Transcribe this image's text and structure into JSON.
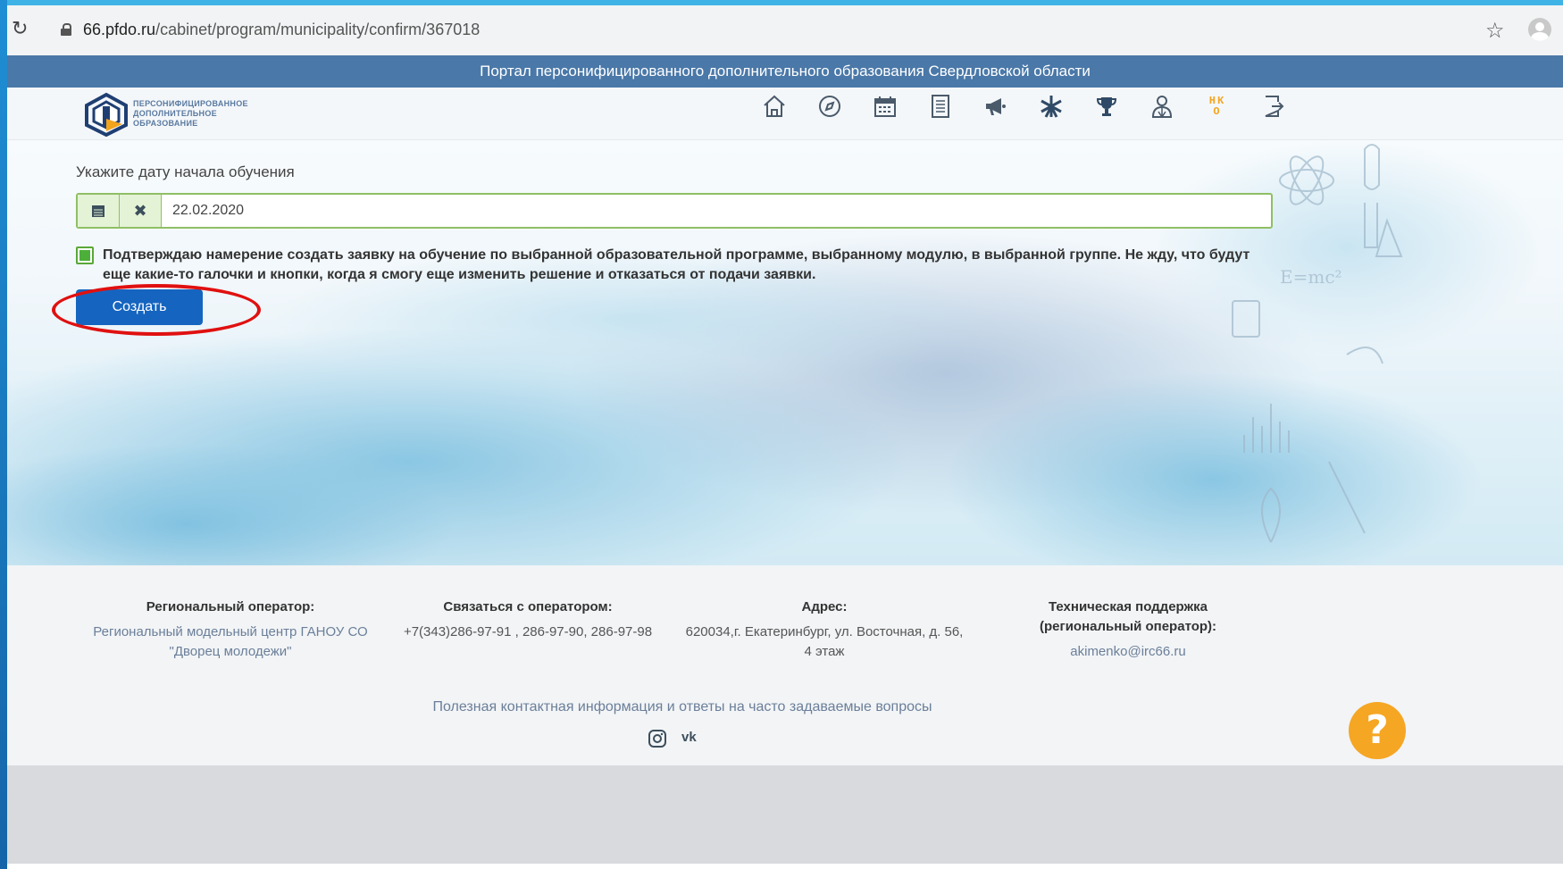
{
  "browser": {
    "url_domain": "66.pfdo.ru",
    "url_path": "/cabinet/program/municipality/confirm/367018"
  },
  "banner": {
    "title": "Портал персонифицированного дополнительного образования Свердловской области"
  },
  "logo": {
    "line1": "ПЕРСОНИФИЦИРОВАННОЕ",
    "line2": "ДОПОЛНИТЕЛЬНОЕ",
    "line3": "ОБРАЗОВАНИЕ"
  },
  "nav_icons": [
    "home-icon",
    "compass-icon",
    "calendar-icon",
    "document-icon",
    "megaphone-icon",
    "star-burst-icon",
    "trophy-icon",
    "users-icon",
    "nko-icon",
    "logout-icon"
  ],
  "nav": {
    "nko_label": "НКО"
  },
  "form": {
    "date_label": "Укажите дату начала обучения",
    "date_value": "22.02.2020",
    "confirm_text": "Подтверждаю намерение создать заявку на обучение по выбранной образовательной программе, выбранному модулю, в выбранной группе. Не жду, что будут еще какие-то галочки и кнопки, когда я смогу еще изменить решение и отказаться от подачи заявки.",
    "checked": true,
    "create_label": "Создать"
  },
  "footer": {
    "col1_title": "Региональный оператор:",
    "col1_value": "Региональный модельный центр ГАНОУ СО \"Дворец молодежи\"",
    "col2_title": "Связаться с оператором:",
    "col2_value": "+7(343)286-97-91 , 286-97-90, 286-97-98",
    "col3_title": "Адрес:",
    "col3_value": "620034,г. Екатеринбург, ул. Восточная, д. 56, 4 этаж",
    "col4_title": "Техническая поддержка (региональный оператор):",
    "col4_value": "akimenko@irc66.ru",
    "help_link": "Полезная контактная информация и ответы на часто задаваемые вопросы",
    "socials": [
      "instagram-icon",
      "vk-icon"
    ],
    "vk_label": "vk"
  },
  "help_bubble": "?",
  "colors": {
    "banner": "#4a78a8",
    "create_button": "#1565c0",
    "check_green": "#4caf3a",
    "annotation_red": "#e01010"
  }
}
